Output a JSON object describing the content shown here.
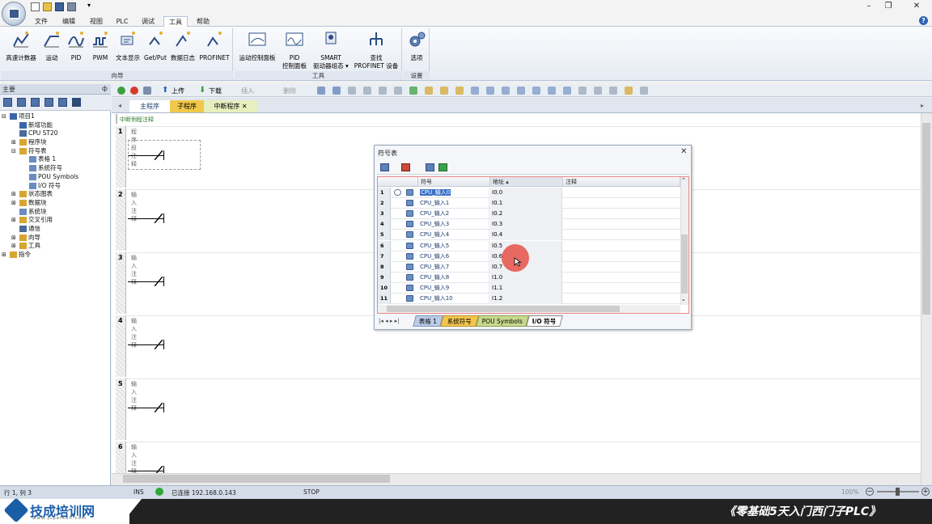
{
  "window": {
    "minimize": "–",
    "restore": "❐",
    "close": "✕",
    "help": "?"
  },
  "menu": [
    "文件",
    "编辑",
    "视图",
    "PLC",
    "调试",
    "工具",
    "帮助"
  ],
  "ribbon": {
    "wizards": {
      "label": "向导",
      "buttons": [
        "高速计数器",
        "运动",
        "PID",
        "PWM",
        "文本显示",
        "Get/Put",
        "数据日志",
        "PROFINET"
      ]
    },
    "tools": {
      "label": "工具",
      "buttons": [
        {
          "l1": "运动控制面板",
          "l2": ""
        },
        {
          "l1": "PID",
          "l2": "控制面板"
        },
        {
          "l1": "SMART",
          "l2": "驱动器组态 ▾"
        },
        {
          "l1": "查找",
          "l2": "PROFINET 设备"
        }
      ]
    },
    "settings": {
      "label": "设置",
      "buttons": [
        "选项"
      ]
    }
  },
  "nav": {
    "header": "主要",
    "pin": "ф",
    "tree": [
      {
        "label": "项目1",
        "level": 0,
        "exp": "⊟"
      },
      {
        "label": "新增功能",
        "level": 1,
        "exp": ""
      },
      {
        "label": "CPU ST20",
        "level": 1,
        "exp": ""
      },
      {
        "label": "程序块",
        "level": 1,
        "exp": "⊞"
      },
      {
        "label": "符号表",
        "level": 1,
        "exp": "⊟"
      },
      {
        "label": "表格 1",
        "level": 2,
        "exp": ""
      },
      {
        "label": "系统符号",
        "level": 2,
        "exp": ""
      },
      {
        "label": "POU Symbols",
        "level": 2,
        "exp": ""
      },
      {
        "label": "I/O 符号",
        "level": 2,
        "exp": ""
      },
      {
        "label": "状态图表",
        "level": 1,
        "exp": "⊞"
      },
      {
        "label": "数据块",
        "level": 1,
        "exp": "⊞"
      },
      {
        "label": "系统块",
        "level": 1,
        "exp": ""
      },
      {
        "label": "交叉引用",
        "level": 1,
        "exp": "⊞"
      },
      {
        "label": "通信",
        "level": 1,
        "exp": ""
      },
      {
        "label": "向导",
        "level": 1,
        "exp": "⊞"
      },
      {
        "label": "工具",
        "level": 1,
        "exp": "⊞"
      },
      {
        "label": "指令",
        "level": 0,
        "exp": "⊞"
      }
    ]
  },
  "editor_toolbar": {
    "upload": "上传",
    "download": "下载",
    "insert": "插入",
    "delete": "删除"
  },
  "program_tabs": [
    "主程序",
    "子程序",
    "中断程序"
  ],
  "tab_close": "✕",
  "editor": {
    "block_comment": "中断例程注释",
    "networks": [
      {
        "num": "1",
        "comment": "程序段注释"
      },
      {
        "num": "2",
        "comment": "输入注释"
      },
      {
        "num": "3",
        "comment": "输入注释"
      },
      {
        "num": "4",
        "comment": "输入注释"
      },
      {
        "num": "5",
        "comment": "输入注释"
      },
      {
        "num": "6",
        "comment": "输入注释"
      }
    ]
  },
  "symbol_table": {
    "title": "符号表",
    "close": "✕",
    "columns": [
      "符号",
      "地址 ▴",
      "注释"
    ],
    "rows": [
      {
        "n": "1",
        "symbol": "CPU_输入0",
        "address": "I0.0"
      },
      {
        "n": "2",
        "symbol": "CPU_输入1",
        "address": "I0.1"
      },
      {
        "n": "3",
        "symbol": "CPU_输入2",
        "address": "I0.2"
      },
      {
        "n": "4",
        "symbol": "CPU_输入3",
        "address": "I0.3"
      },
      {
        "n": "5",
        "symbol": "CPU_输入4",
        "address": "I0.4"
      },
      {
        "n": "6",
        "symbol": "CPU_输入5",
        "address": "I0.5"
      },
      {
        "n": "7",
        "symbol": "CPU_输入6",
        "address": "I0.6"
      },
      {
        "n": "8",
        "symbol": "CPU_输入7",
        "address": "I0.7"
      },
      {
        "n": "9",
        "symbol": "CPU_输入8",
        "address": "I1.0"
      },
      {
        "n": "10",
        "symbol": "CPU_输入9",
        "address": "I1.1"
      },
      {
        "n": "11",
        "symbol": "CPU_输入10",
        "address": "I1.2"
      }
    ],
    "sheets": [
      "表格 1",
      "系统符号",
      "POU Symbols",
      "I/O 符号"
    ],
    "nav_arrows": "|◂ ◂ ▸ ▸|"
  },
  "status": {
    "position": "行 1, 列 3",
    "mode": "INS",
    "connection": "已连接 192.168.0.143",
    "state": "STOP",
    "zoom": "100%"
  },
  "brand": {
    "name": "技成培训网",
    "url": "www.jcpeixun.com",
    "course": "《零基础5天入门西门子PLC》"
  }
}
